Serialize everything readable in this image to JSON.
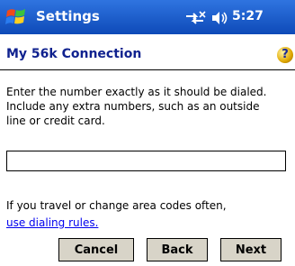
{
  "titlebar": {
    "app_title": "Settings",
    "time": "5:27",
    "icons": [
      "windows-start-icon",
      "connectivity-icon",
      "volume-icon"
    ]
  },
  "header": {
    "title": "My 56k Connection",
    "help_symbol": "?"
  },
  "body": {
    "instructions": "Enter the number exactly as it should be dialed.  Include any extra numbers, such as an outside line or credit card.",
    "number_value": "",
    "travel_text": "If you travel or change area codes often,",
    "dialing_link": "use dialing rules."
  },
  "buttons": {
    "cancel": "Cancel",
    "back": "Back",
    "next": "Next"
  },
  "colors": {
    "titlebar": "#1456c8",
    "header_text": "#10228f",
    "link": "#0000ee",
    "button_bg": "#d8d4c8"
  }
}
